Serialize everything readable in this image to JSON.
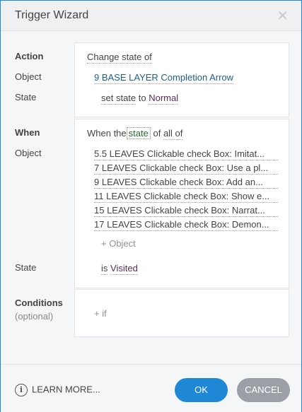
{
  "dialog": {
    "title": "Trigger Wizard",
    "close_glyph": "✕"
  },
  "action": {
    "label": "Action",
    "value": "Change state of",
    "object_label": "Object",
    "object_value": "9 BASE LAYER Completion Arrow",
    "state_label": "State",
    "state_prefix": "set state",
    "state_to": "to",
    "state_value": "Normal"
  },
  "when": {
    "label": "When",
    "text_before": "When the",
    "state_word": "state",
    "text_of": "of",
    "text_all": "all of",
    "object_label": "Object",
    "objects": [
      "5.5  LEAVES Clickable check Box:  Imitat...",
      "7  LEAVES Clickable check Box:  Use a pl...",
      "9   LEAVES Clickable check Box:  Add an...",
      "11  LEAVES Clickable check Box: Show e...",
      "15   LEAVES Clickable check Box:  Narrat...",
      "17  LEAVES Clickable check Box:  Demon..."
    ],
    "add_object": "+ Object",
    "state_label": "State",
    "state_prefix": "is",
    "state_value": "Visited"
  },
  "conditions": {
    "label": "Conditions",
    "sublabel": "(optional)",
    "add_if": "+ if"
  },
  "footer": {
    "learn_more": "LEARN MORE...",
    "ok": "OK",
    "cancel": "CANCEL"
  },
  "colors": {
    "accent": "#1e88d6",
    "cancel": "#9aa0a6",
    "link": "#1c5f8c",
    "state_value": "#5a2c58"
  }
}
